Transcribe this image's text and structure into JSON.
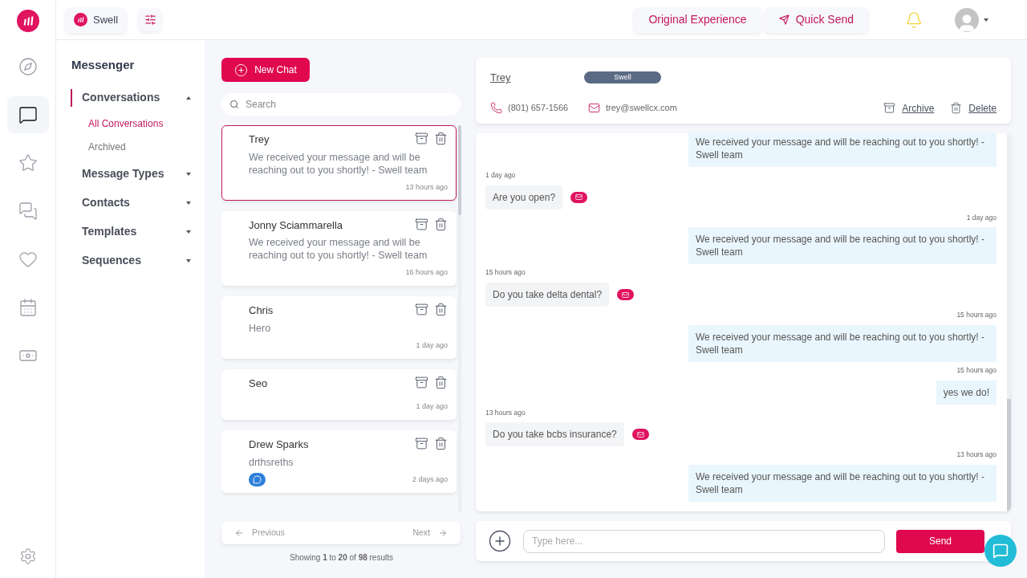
{
  "nav_rail": [
    {
      "selected": false
    },
    {
      "selected": true
    },
    {
      "selected": false
    },
    {
      "selected": false
    },
    {
      "selected": false
    },
    {
      "selected": false
    },
    {
      "selected": false
    }
  ],
  "top_bar": {
    "workspace": "Swell",
    "buttons": [
      "Original Experience",
      "Quick Send"
    ]
  },
  "sidebar": {
    "title": "Messenger",
    "sections": [
      {
        "label": "Conversations",
        "expanded": true,
        "selected": true,
        "children": [
          {
            "label": "All Conversations",
            "selected": true
          },
          {
            "label": "Archived",
            "selected": false
          }
        ]
      },
      {
        "label": "Message Types",
        "expanded": false,
        "selected": false
      },
      {
        "label": "Contacts",
        "expanded": false,
        "selected": false
      },
      {
        "label": "Templates",
        "expanded": false,
        "selected": false
      },
      {
        "label": "Sequences",
        "expanded": false,
        "selected": false
      }
    ]
  },
  "new_chat": "New Chat",
  "search": {
    "placeholder": "Search"
  },
  "conversations": [
    {
      "name": "Trey",
      "preview": "We received your message and will be reaching out to you shortly! - Swell team",
      "time": "13 hours ago",
      "selected": true,
      "messenger": false
    },
    {
      "name": "Jonny Sciammarella",
      "preview": "We received your message and will be reaching out to you shortly! - Swell team",
      "time": "16 hours ago",
      "selected": false,
      "messenger": false
    },
    {
      "name": "Chris",
      "preview": "Hero",
      "time": "1 day ago",
      "selected": false,
      "messenger": false
    },
    {
      "name": "Seo",
      "time": "1 day ago",
      "selected": false,
      "messenger": false
    },
    {
      "name": "Drew Sparks",
      "preview": "drthsreths",
      "time": "2 days ago",
      "selected": false,
      "messenger": true
    }
  ],
  "pagination": {
    "previous": "Previous",
    "next": "Next",
    "summary": "Showing **1** to **20** of **98** results"
  },
  "contact": {
    "name": "Trey",
    "tag": "Swell",
    "phone": "(801) 657-1566",
    "email": "trey@swellcx.com",
    "actions": [
      "Archive",
      "Delete"
    ]
  },
  "messages": [
    {
      "kind": "outgoing",
      "text": "We received your message and will be reaching out to you shortly! - Swell team"
    },
    {
      "kind": "incoming",
      "time": "1 day ago",
      "text": "Are you open?"
    },
    {
      "kind": "outgoing",
      "time": "1 day ago",
      "text": "We received your message and will be reaching out to you shortly! - Swell team"
    },
    {
      "kind": "incoming",
      "time": "15 hours ago",
      "text": "Do you take delta dental?"
    },
    {
      "kind": "outgoing",
      "time": "15 hours ago",
      "text": "We received your message and will be reaching out to you shortly! - Swell team"
    },
    {
      "kind": "outgoing",
      "time": "15 hours ago",
      "text": "yes we do!"
    },
    {
      "kind": "incoming",
      "time": "13 hours ago",
      "text": "Do you take bcbs insurance?"
    },
    {
      "kind": "outgoing",
      "time": "13 hours ago",
      "text": "We received your message and will be reaching out to you shortly! - Swell team"
    }
  ],
  "composer": {
    "placeholder": "Type here...",
    "send": "Send"
  }
}
